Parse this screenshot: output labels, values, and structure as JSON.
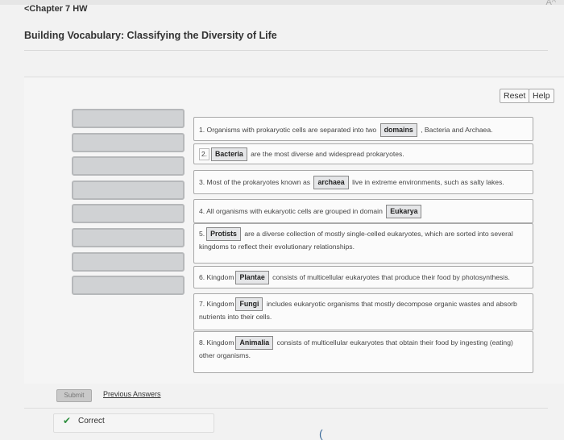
{
  "header": {
    "breadcrumb": "<Chapter 7 HW",
    "title": "Building Vocabulary: Classifying the Diversity of Life",
    "aa_icon": "A^"
  },
  "toolbar": {
    "reset": "Reset",
    "help": "Help"
  },
  "bank_slots": 8,
  "items": [
    {
      "pre": "1. Organisms with prokaryotic cells are separated into two",
      "answer": "domains",
      "post": ", Bacteria and Archaea."
    },
    {
      "pre": "2.",
      "answer": "Bacteria",
      "post": "are the most diverse and widespread prokaryotes."
    },
    {
      "pre": "3. Most of the prokaryotes known as",
      "answer": "archaea",
      "post": "live in extreme environments, such as salty lakes."
    },
    {
      "pre": "4. All organisms with eukaryotic cells are grouped in domain",
      "answer": "Eukarya",
      "post": ""
    },
    {
      "pre": "5.",
      "answer": "Protists",
      "post": "are a diverse collection of mostly single-celled eukaryotes, which are sorted into several kingdoms to reflect their evolutionary relationships."
    },
    {
      "pre": "6. Kingdom",
      "answer": "Plantae",
      "post": "consists of multicellular eukaryotes that produce their food by photosynthesis."
    },
    {
      "pre": "7. Kingdom",
      "answer": "Fungi",
      "post": "includes eukaryotic organisms that mostly decompose organic wastes and absorb nutrients into their cells."
    },
    {
      "pre": "8. Kingdom",
      "answer": "Animalia",
      "post": "consists of multicellular eukaryotes that obtain their food by ingesting (eating) other organisms."
    }
  ],
  "footer": {
    "submit": "Submit",
    "previous_answers": "Previous Answers",
    "result": "Correct",
    "check_icon": "✔"
  }
}
